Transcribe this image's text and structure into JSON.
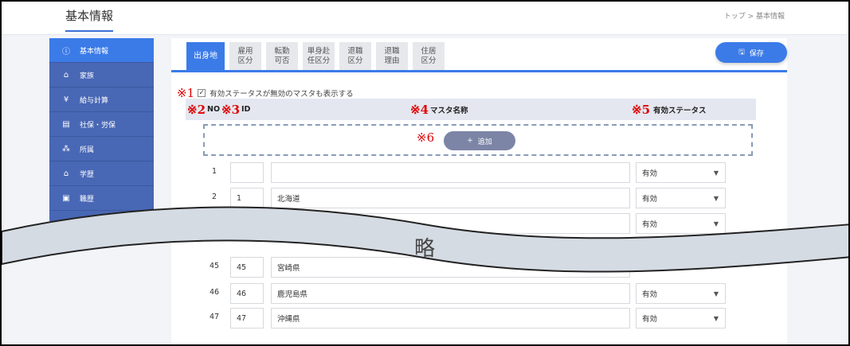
{
  "header": {
    "title": "基本情報",
    "breadcrumb": "トップ > 基本情報"
  },
  "sidebar": {
    "items": [
      {
        "label": "基本情報",
        "icon": "info-icon",
        "active": true
      },
      {
        "label": "家族",
        "icon": "house-icon"
      },
      {
        "label": "給与計算",
        "icon": "yen-icon"
      },
      {
        "label": "社保・労保",
        "icon": "document-icon"
      },
      {
        "label": "所属",
        "icon": "org-chart-icon"
      },
      {
        "label": "学歴",
        "icon": "graduation-cap-icon"
      },
      {
        "label": "職歴",
        "icon": "briefcase-icon"
      }
    ]
  },
  "tabs": [
    {
      "label": "出身地",
      "active": true
    },
    {
      "label": "雇用\n区分"
    },
    {
      "label": "転勤\n可否"
    },
    {
      "label": "単身赴\n任区分"
    },
    {
      "label": "退職\n区分"
    },
    {
      "label": "退職\n理由"
    },
    {
      "label": "住居\n区分"
    }
  ],
  "toolbar": {
    "save_label": "保存"
  },
  "annotations": {
    "n1": "※1",
    "n2": "※2",
    "n3": "※3",
    "n4": "※4",
    "n5": "※5",
    "n6": "※6"
  },
  "filter": {
    "checkbox_label": "有効ステータスが無効のマスタも表示する",
    "checked": true
  },
  "table": {
    "headers": {
      "no": "NO",
      "id": "ID",
      "name": "マスタ名称",
      "status": "有効ステータス"
    },
    "add_label": "追加",
    "rows_top": [
      {
        "no": "1",
        "id": "",
        "name": "",
        "status": "有効"
      },
      {
        "no": "2",
        "id": "1",
        "name": "北海道",
        "status": "有効"
      },
      {
        "no": "",
        "id": "",
        "name": "",
        "status": "有効"
      }
    ],
    "rows_bottom": [
      {
        "no": "45",
        "id": "45",
        "name": "宮崎県",
        "status": ""
      },
      {
        "no": "46",
        "id": "46",
        "name": "鹿児島県",
        "status": "有効"
      },
      {
        "no": "47",
        "id": "47",
        "name": "沖縄県",
        "status": "有効"
      }
    ]
  },
  "omission_label": "略",
  "colors": {
    "accent": "#3b7be8",
    "sidebar": "#4867b5",
    "annotation": "#e00000"
  }
}
